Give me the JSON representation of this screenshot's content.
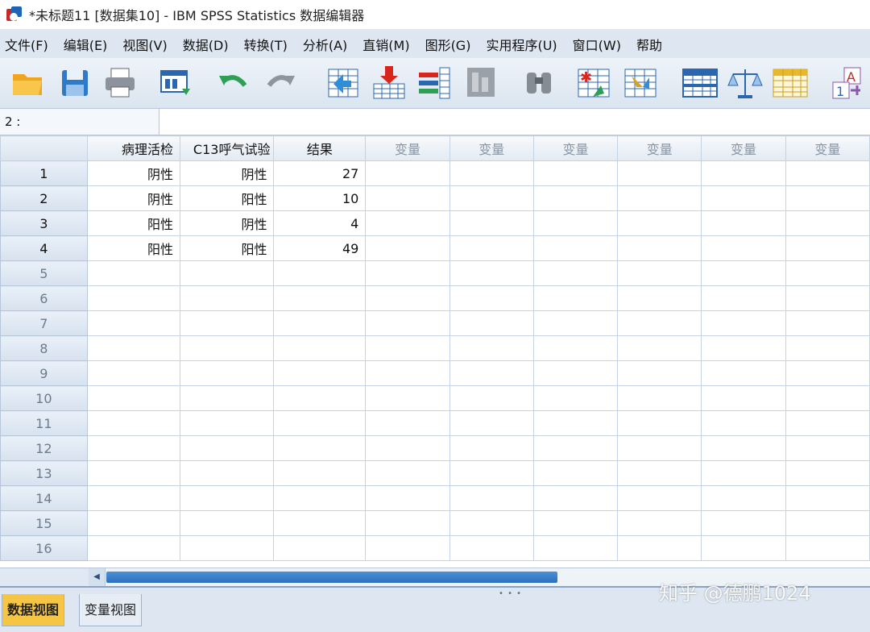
{
  "window": {
    "title": "*未标题11 [数据集10] - IBM SPSS Statistics 数据编辑器"
  },
  "menu": [
    {
      "label": "文件(F)"
    },
    {
      "label": "编辑(E)"
    },
    {
      "label": "视图(V)"
    },
    {
      "label": "数据(D)"
    },
    {
      "label": "转换(T)"
    },
    {
      "label": "分析(A)"
    },
    {
      "label": "直销(M)"
    },
    {
      "label": "图形(G)"
    },
    {
      "label": "实用程序(U)"
    },
    {
      "label": "窗口(W)"
    },
    {
      "label": "帮助"
    }
  ],
  "toolbar": {
    "buttons": [
      {
        "icon": "open-folder-icon"
      },
      {
        "icon": "save-icon"
      },
      {
        "icon": "print-icon"
      },
      {
        "icon": "dialog-recall-icon"
      },
      {
        "icon": "undo-icon"
      },
      {
        "icon": "redo-icon"
      },
      {
        "icon": "goto-case-icon"
      },
      {
        "icon": "goto-variable-icon"
      },
      {
        "icon": "variables-icon"
      },
      {
        "icon": "run-descriptives-icon"
      },
      {
        "icon": "find-icon"
      },
      {
        "icon": "insert-cases-icon"
      },
      {
        "icon": "insert-variable-icon"
      },
      {
        "icon": "split-file-icon"
      },
      {
        "icon": "weight-cases-icon"
      },
      {
        "icon": "select-cases-icon"
      },
      {
        "icon": "value-labels-icon"
      }
    ]
  },
  "refbar": {
    "cell_ref": "2 :",
    "cell_value": ""
  },
  "grid": {
    "columns": [
      "病理活检",
      "C13呼气试验",
      "结果",
      "变量",
      "变量",
      "变量",
      "变量",
      "变量",
      "变量"
    ],
    "rows": [
      {
        "num": "1",
        "cells": [
          "阴性",
          "阴性",
          "27"
        ]
      },
      {
        "num": "2",
        "cells": [
          "阴性",
          "阳性",
          "10"
        ]
      },
      {
        "num": "3",
        "cells": [
          "阳性",
          "阴性",
          "4"
        ]
      },
      {
        "num": "4",
        "cells": [
          "阳性",
          "阳性",
          "49"
        ]
      },
      {
        "num": "5",
        "cells": [
          "",
          "",
          ""
        ]
      },
      {
        "num": "6",
        "cells": [
          "",
          "",
          ""
        ]
      },
      {
        "num": "7",
        "cells": [
          "",
          "",
          ""
        ]
      },
      {
        "num": "8",
        "cells": [
          "",
          "",
          ""
        ]
      },
      {
        "num": "9",
        "cells": [
          "",
          "",
          ""
        ]
      },
      {
        "num": "10",
        "cells": [
          "",
          "",
          ""
        ]
      },
      {
        "num": "11",
        "cells": [
          "",
          "",
          ""
        ]
      },
      {
        "num": "12",
        "cells": [
          "",
          "",
          ""
        ]
      },
      {
        "num": "13",
        "cells": [
          "",
          "",
          ""
        ]
      },
      {
        "num": "14",
        "cells": [
          "",
          "",
          ""
        ]
      },
      {
        "num": "15",
        "cells": [
          "",
          "",
          ""
        ]
      },
      {
        "num": "16",
        "cells": [
          "",
          "",
          ""
        ]
      }
    ]
  },
  "tabs": {
    "data_view": "数据视图",
    "variable_view": "变量视图"
  },
  "watermark": "知乎 @德鹏1024",
  "colors": {
    "active_tab": "#f6c544",
    "scroll_thumb": "#2d6fbd",
    "grid_line": "#c5d2e2"
  }
}
